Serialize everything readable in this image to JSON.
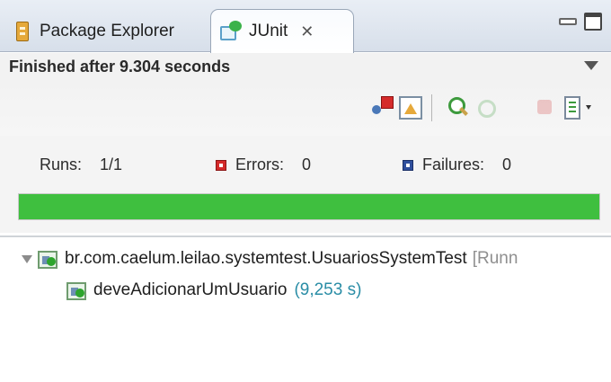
{
  "tabs": {
    "package_explorer": "Package Explorer",
    "junit": "JUnit",
    "close_glyph": "✕"
  },
  "status": {
    "message": "Finished after 9.304 seconds"
  },
  "counters": {
    "runs_label": "Runs:",
    "runs_value": "1/1",
    "errors_label": "Errors:",
    "errors_value": "0",
    "failures_label": "Failures:",
    "failures_value": "0"
  },
  "progress": {
    "fraction": 1.0,
    "color": "#3fbf3f"
  },
  "tree": {
    "suite": {
      "name": "br.com.caelum.leilao.systemtest.UsuariosSystemTest",
      "meta": "[Runn"
    },
    "test_case": {
      "name": "deveAdicionarUmUsuario",
      "time": "(9,253 s)"
    }
  },
  "toolbar": {
    "icons": [
      "next-failure-icon",
      "previous-failure-icon",
      "scroll-lock-icon",
      "rerun-icon",
      "stop-icon",
      "history-icon",
      "view-menu-icon"
    ]
  }
}
